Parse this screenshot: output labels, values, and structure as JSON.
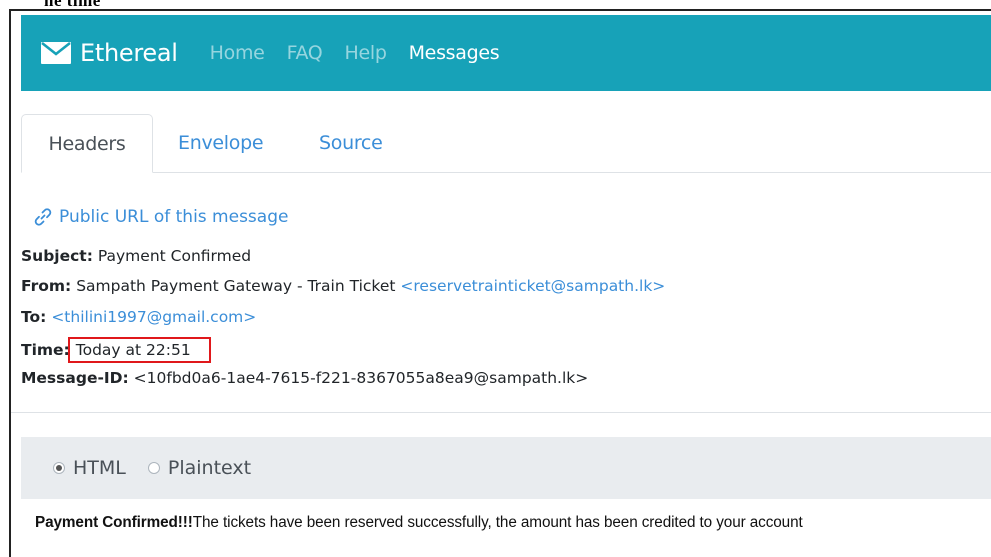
{
  "caption": "he time",
  "navbar": {
    "brand": "Ethereal",
    "links": [
      "Home",
      "FAQ",
      "Help",
      "Messages"
    ],
    "active": "Messages",
    "color": "#17a2b8"
  },
  "tabs": [
    {
      "label": "Headers",
      "active": true
    },
    {
      "label": "Envelope",
      "active": false
    },
    {
      "label": "Source",
      "active": false
    }
  ],
  "public_url_label": "Public URL of this message",
  "headers": {
    "subject": {
      "label": "Subject:",
      "value": "Payment Confirmed"
    },
    "from": {
      "label": "From:",
      "name": "Sampath Payment Gateway - Train Ticket",
      "email": "<reservetrainticket@sampath.lk>"
    },
    "to": {
      "label": "To:",
      "email": "<thilini1997@gmail.com>"
    },
    "time": {
      "label": "Time:",
      "value": "Today at 22:51"
    },
    "message_id": {
      "label": "Message-ID:",
      "value": "<10fbd0a6-1ae4-7615-f221-8367055a8ea9@sampath.lk>"
    }
  },
  "format": {
    "options": [
      "HTML",
      "Plaintext"
    ],
    "selected": "HTML"
  },
  "body": {
    "bold": "Payment Confirmed!!!",
    "rest": "The tickets have been reserved successfully, the amount has been credited to your account"
  },
  "highlight_color": "#e0181b"
}
